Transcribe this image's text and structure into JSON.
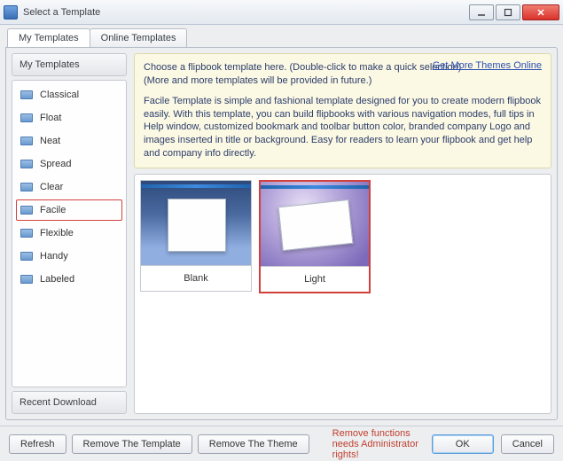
{
  "window": {
    "title": "Select a Template"
  },
  "tabs": {
    "my": "My Templates",
    "online": "Online Templates"
  },
  "sidebar": {
    "header": "My Templates",
    "items": [
      {
        "label": "Classical"
      },
      {
        "label": "Float"
      },
      {
        "label": "Neat"
      },
      {
        "label": "Spread"
      },
      {
        "label": "Clear"
      },
      {
        "label": "Facile"
      },
      {
        "label": "Flexible"
      },
      {
        "label": "Handy"
      },
      {
        "label": "Labeled"
      }
    ],
    "recent": "Recent Download"
  },
  "info": {
    "line1": "Choose a flipbook template here. (Double-click to make a quick selection)",
    "line2": "(More and more templates will be provided in future.)",
    "link": "Get More Themes Online",
    "desc": "Facile Template is simple and fashional template designed for you to create modern flipbook easily. With this template, you can build flipbooks with various navigation modes, full tips in Help window, customized bookmark and toolbar button color, branded company Logo and images inserted in title or background. Easy for readers to learn your flipbook and get help and company info directly."
  },
  "thumbs": {
    "blank": "Blank",
    "light": "Light"
  },
  "footer": {
    "refresh": "Refresh",
    "removeTemplate": "Remove The Template",
    "removeTheme": "Remove The Theme",
    "warn": "Remove functions needs Administrator rights!",
    "ok": "OK",
    "cancel": "Cancel"
  }
}
